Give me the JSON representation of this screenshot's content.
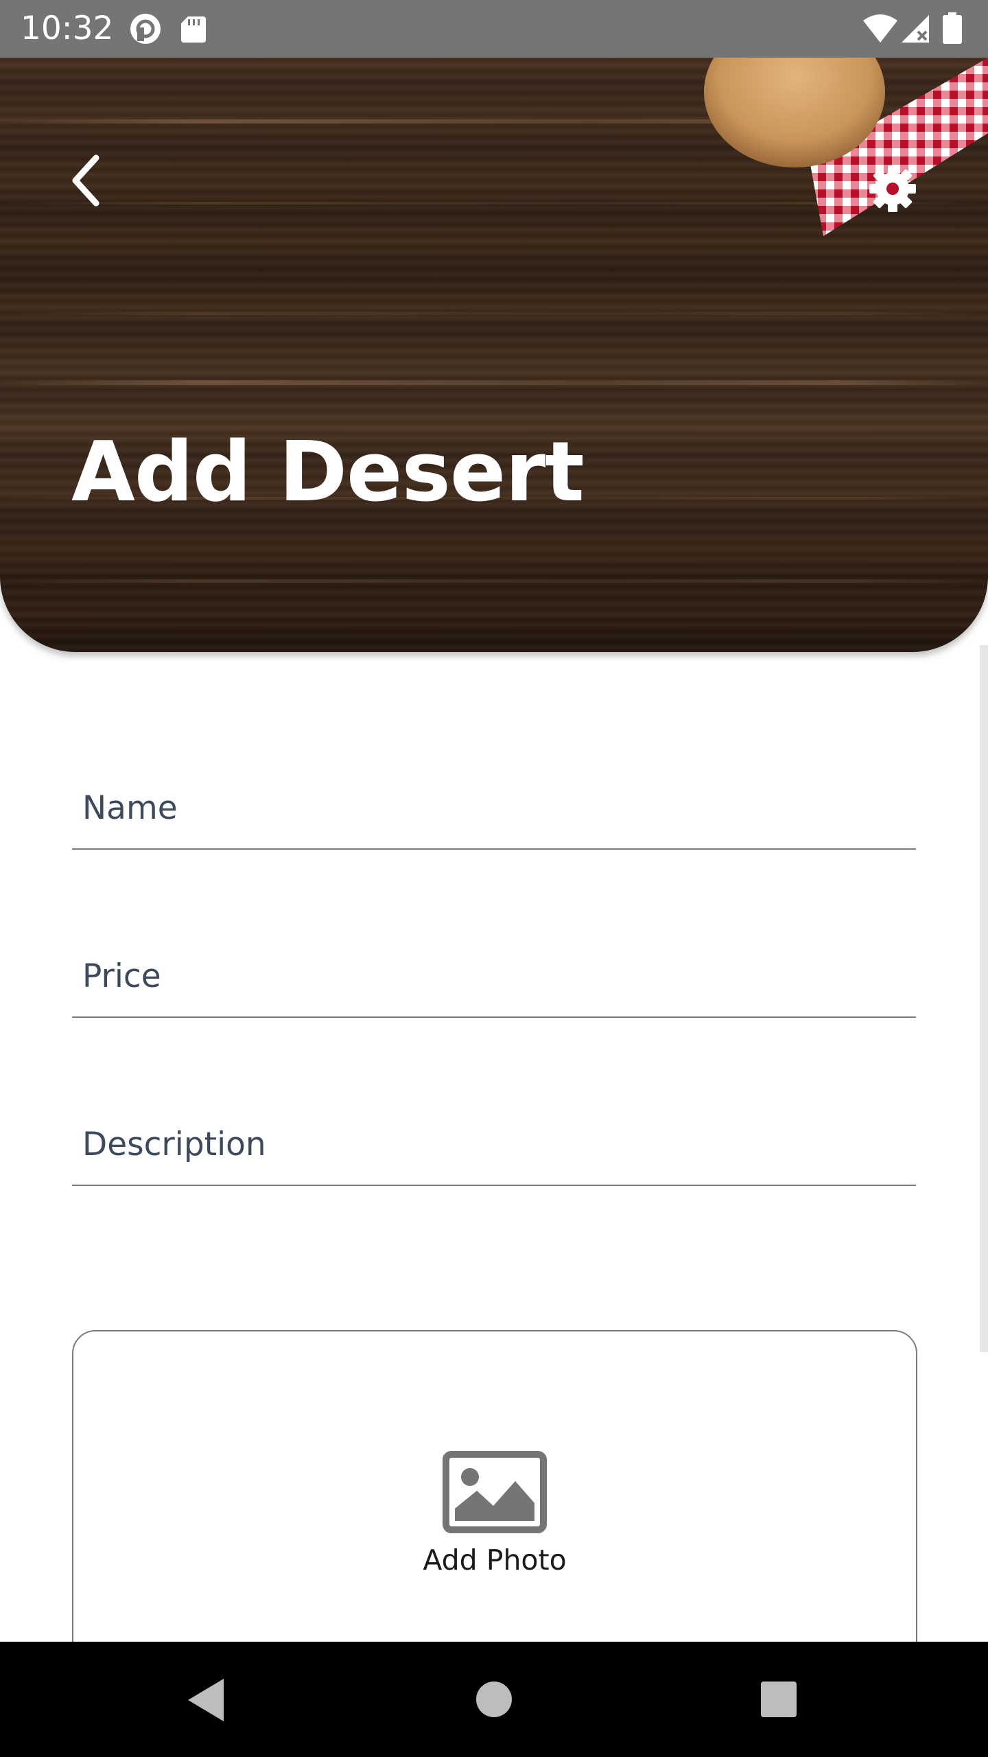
{
  "status_bar": {
    "time": "10:32",
    "left_icons": [
      "pocket-casts-icon",
      "sd-card-icon"
    ],
    "right_icons": [
      "wifi-icon",
      "cell-signal-icon",
      "battery-icon"
    ]
  },
  "header": {
    "title": "Add Desert",
    "back_icon": "chevron-left-icon",
    "settings_icon": "gear-icon"
  },
  "form": {
    "name_label": "Name",
    "price_label": "Price",
    "description_label": "Description"
  },
  "photo": {
    "label": "Add Photo",
    "icon": "image-icon"
  },
  "nav_bar": {
    "buttons": [
      "back-triangle-icon",
      "home-circle-icon",
      "recents-square-icon"
    ]
  }
}
